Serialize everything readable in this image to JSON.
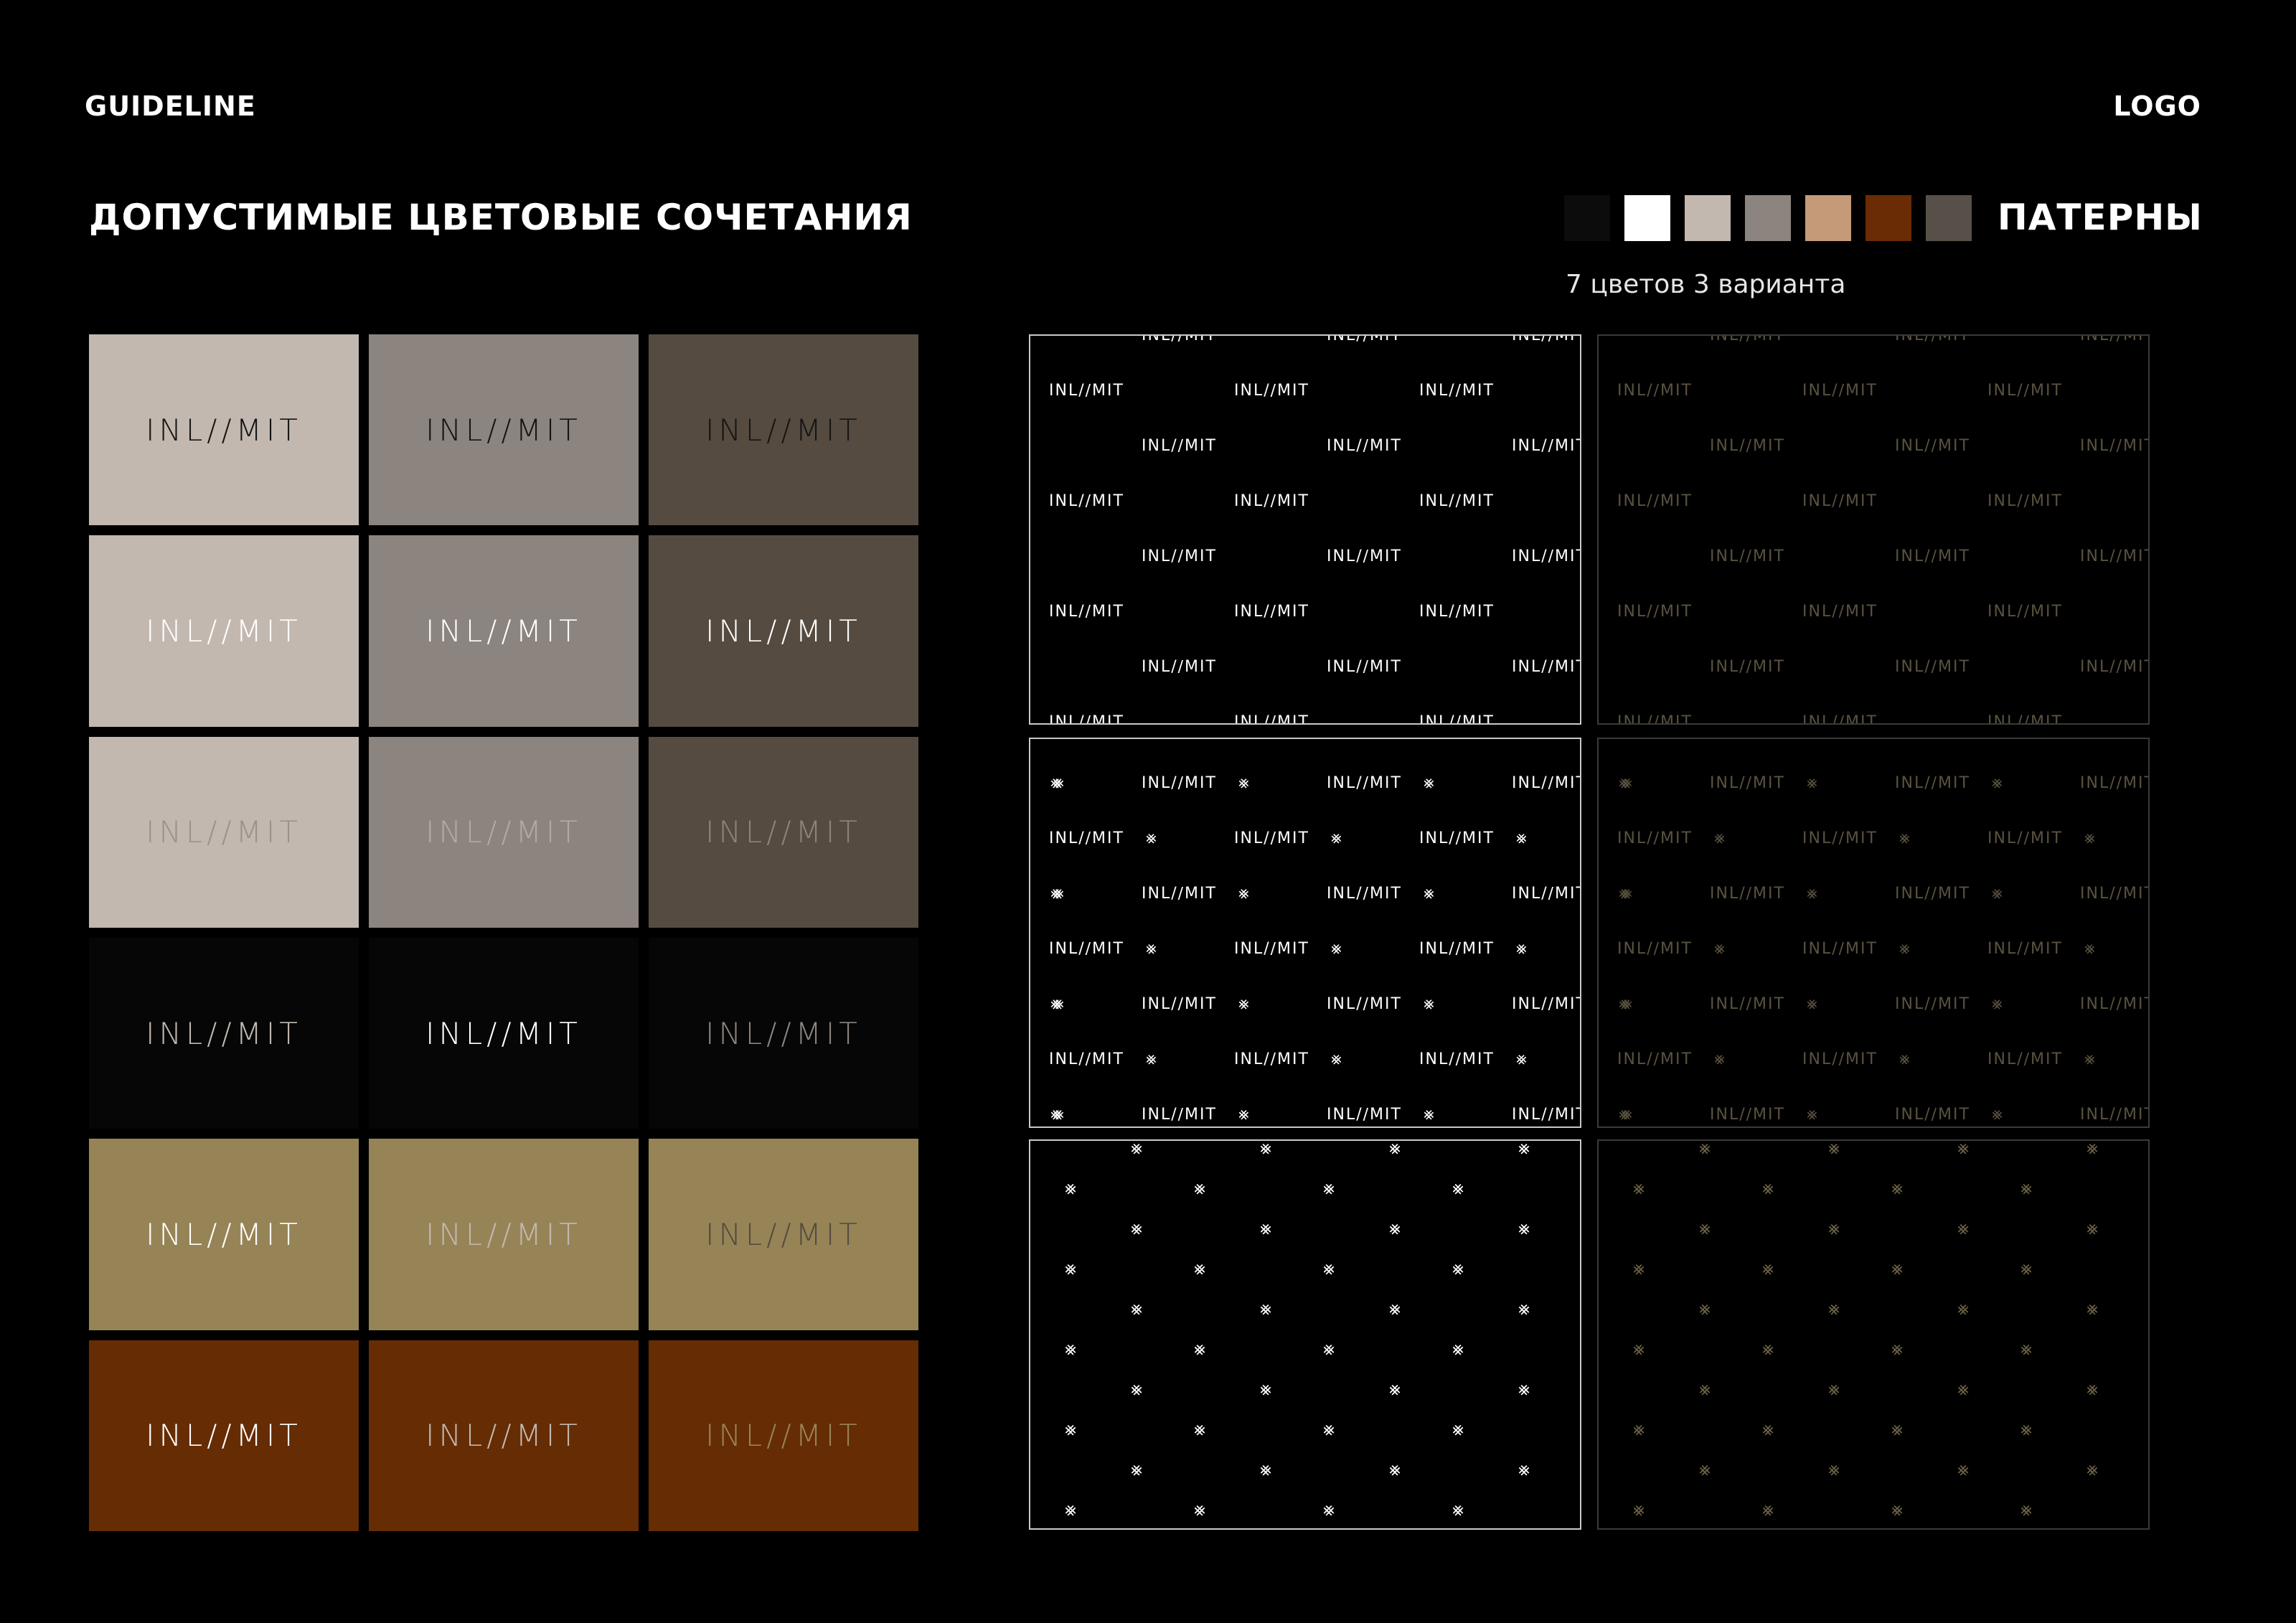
{
  "header": {
    "left": "GUIDELINE",
    "right": "LOGO"
  },
  "section": {
    "title": "ДОПУСТИМЫЕ ЦВЕТОВЫЕ СОЧЕТАНИЯ"
  },
  "patterns": {
    "title": "ПАТЕРНЫ",
    "subtitle": "7 цветов 3 варианта"
  },
  "logo_text": "INL/∕MIT",
  "palette": [
    "#0c0c0c",
    "#ffffff",
    "#c2b8b0",
    "#8c847e",
    "#c49a78",
    "#6a2c04",
    "#575048"
  ],
  "combinations": [
    {
      "bg": "#c2b8b0",
      "fg": "#151515"
    },
    {
      "bg": "#8c847e",
      "fg": "#151515"
    },
    {
      "bg": "#554b40",
      "fg": "#151515"
    },
    {
      "bg": "#c2b8b0",
      "fg": "#ffffff"
    },
    {
      "bg": "#8c847e",
      "fg": "#ffffff"
    },
    {
      "bg": "#554b40",
      "fg": "#ffffff"
    },
    {
      "bg": "#c2b8b0",
      "fg": "#9a928b"
    },
    {
      "bg": "#8c847e",
      "fg": "#b3aaa3"
    },
    {
      "bg": "#554b40",
      "fg": "#8c847e"
    },
    {
      "bg": "#060606",
      "fg": "#c2b8b0"
    },
    {
      "bg": "#060606",
      "fg": "#ffffff"
    },
    {
      "bg": "#060606",
      "fg": "#8c847e"
    },
    {
      "bg": "#978456",
      "fg": "#ffffff"
    },
    {
      "bg": "#978456",
      "fg": "#c2b8b0"
    },
    {
      "bg": "#978456",
      "fg": "#554b40"
    },
    {
      "bg": "#662c04",
      "fg": "#ffffff"
    },
    {
      "bg": "#662c04",
      "fg": "#c2b8b0"
    },
    {
      "bg": "#662c04",
      "fg": "#978456"
    }
  ],
  "pattern_tiles": [
    {
      "variant": "wordmark",
      "fg": "#ffffff",
      "border": "#c9c9c9"
    },
    {
      "variant": "wordmark",
      "fg": "#5a5240",
      "border": "#3a3a3a"
    },
    {
      "variant": "wordmark-monogram",
      "fg": "#ffffff",
      "border": "#c9c9c9"
    },
    {
      "variant": "wordmark-monogram",
      "fg": "#5a5240",
      "border": "#3a3a3a"
    },
    {
      "variant": "monogram",
      "fg": "#ffffff",
      "border": "#c9c9c9"
    },
    {
      "variant": "monogram",
      "fg": "#6b6146",
      "border": "#3a3a3a"
    }
  ],
  "monogram": "⨳"
}
